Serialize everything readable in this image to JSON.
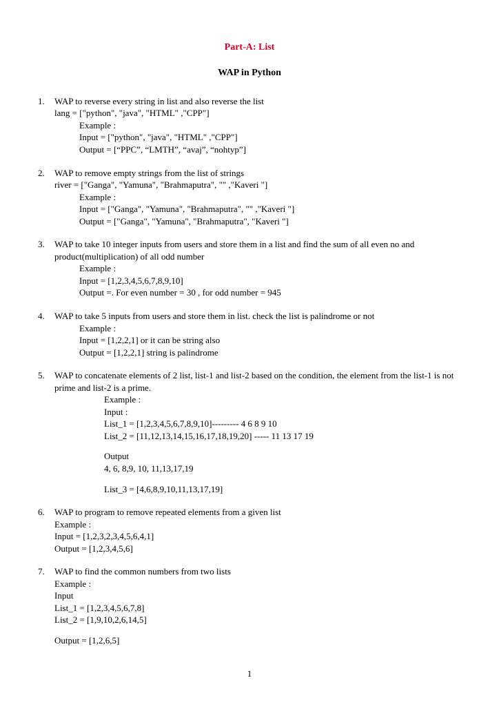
{
  "partTitle": "Part-A: List",
  "subtitle": "WAP in Python",
  "pageNumber": "1",
  "q1": {
    "num": "1.",
    "text": "WAP to reverse every string in list and also reverse the list",
    "l1": "lang = [\"python\", \"java\", \"HTML\" ,\"CPP\"]",
    "l2": "Example :",
    "l3": "Input = [\"python\", \"java\", \"HTML\" ,\"CPP\"]",
    "l4": "Output = [“PPC”, “LMTH”, “avaj”, “nohtyp”]"
  },
  "q2": {
    "num": "2.",
    "text": "WAP to remove empty strings from the list of strings",
    "l1": "river = [\"Ganga\", \"Yamuna\", \"Brahmaputra\", \"\" ,\"Kaveri \"]",
    "l2": "Example :",
    "l3": "Input = [\"Ganga\", \"Yamuna\", \"Brahmaputra\", \"\" ,\"Kaveri \"]",
    "l4": "Output = [\"Ganga\", \"Yamuna\", \"Brahmaputra\", \"Kaveri \"]"
  },
  "q3": {
    "num": "3.",
    "text": "WAP to take 10 integer inputs from users and store them in a list and find the sum of all even no and product(multiplication) of all odd number",
    "l1": "Example :",
    "l2": "Input = [1,2,3,4,5,6,7,8,9,10]",
    "l3": "Output =. For even number = 30 , for odd number = 945"
  },
  "q4": {
    "num": "4.",
    "text": "WAP to take 5  inputs from users and store them in list. check the list is palindrome or not",
    "l1": "Example :",
    "l2": "Input = [1,2,2,1] or it can be string also",
    "l3": "Output = [1,2,2,1] string is palindrome"
  },
  "q5": {
    "num": "5.",
    "text": "WAP to concatenate elements of 2 list, list-1 and list-2 based on the condition, the element from the list-1 is not prime and list-2 is a prime.",
    "l1": "Example :",
    "l2": "Input :",
    "l3": "List_1 = [1,2,3,4,5,6,7,8,9,10]--------- 4 6 8 9 10",
    "l4": "List_2 = [11,12,13,14,15,16,17,18,19,20] ----- 11 13 17 19",
    "l5": "Output",
    "l6": "4, 6, 8,9, 10, 11,13,17,19",
    "l7": "List_3 = [4,6,8,9,10,11,13,17,19]"
  },
  "q6": {
    "num": "6.",
    "text": "WAP to program to remove repeated elements from a given list",
    "l1": "Example :",
    "l2": "Input = [1,2,3,2,3,4,5,6,4,1]",
    "l3": "Output = [1,2,3,4,5,6]"
  },
  "q7": {
    "num": "7.",
    "text": "WAP to find the common numbers from two lists",
    "l1": "Example :",
    "l2": "Input",
    "l3": "List_1 = [1,2,3,4,5,6,7,8]",
    "l4": "List_2 = [1,9,10,2,6,14,5]",
    "l5": "Output = [1,2,6,5]"
  }
}
